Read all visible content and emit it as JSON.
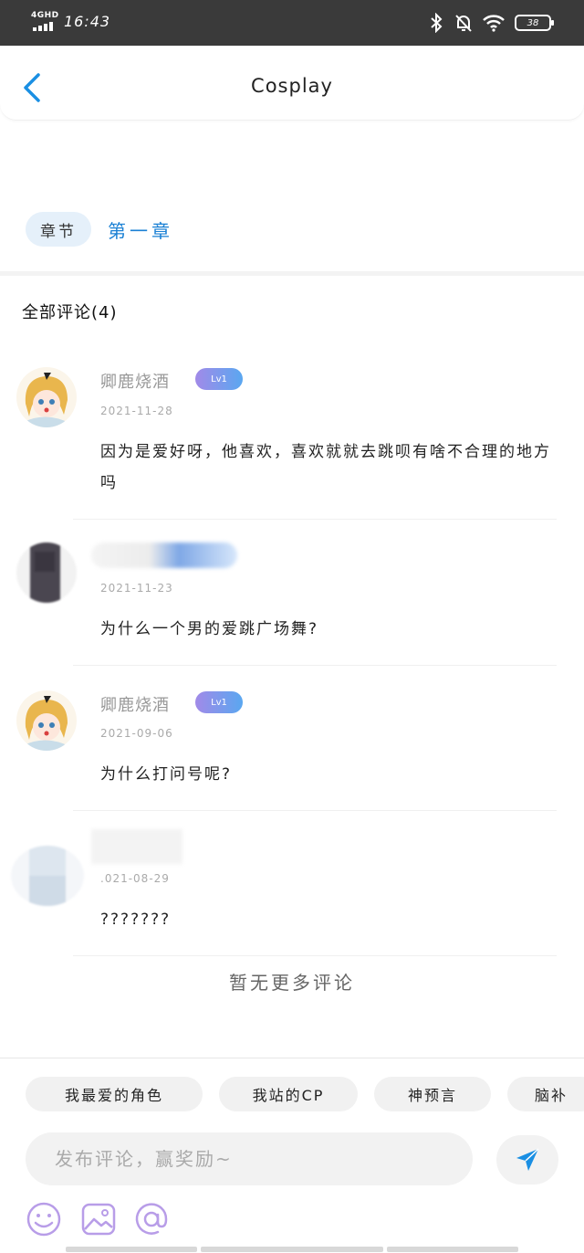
{
  "status_bar": {
    "network": "4GHD",
    "time": "16:43",
    "battery": "38"
  },
  "header": {
    "title": "Cosplay"
  },
  "chapter": {
    "tag": "章节",
    "name": "第一章"
  },
  "comments_section": {
    "title": "全部评论(4)",
    "comments": [
      {
        "name": "卿鹿烧酒",
        "level": "Lv1",
        "date": "2021-11-28",
        "text": "因为是爱好呀，他喜欢，喜欢就就去跳呗有啥不合理的地方吗"
      },
      {
        "name": "",
        "level": "",
        "date": "2021-11-23",
        "text": "为什么一个男的爱跳广场舞?"
      },
      {
        "name": "卿鹿烧酒",
        "level": "Lv1",
        "date": "2021-09-06",
        "text": "为什么打问号呢?"
      },
      {
        "name": "",
        "level": "",
        "date": ".021-08-29",
        "text": "???????"
      }
    ],
    "no_more": "暂无更多评论"
  },
  "bottom_bar": {
    "quick_replies": [
      "我最爱的角色",
      "我站的CP",
      "神预言",
      "脑补"
    ],
    "input_placeholder": "发布评论，赢奖励~",
    "send_icon": "paper-plane-icon",
    "tools": [
      "emoji-icon",
      "image-icon",
      "at-icon"
    ]
  },
  "colors": {
    "accent": "#1a80d4",
    "tool_icon": "#b89de8",
    "send": "#1a8fe3"
  }
}
